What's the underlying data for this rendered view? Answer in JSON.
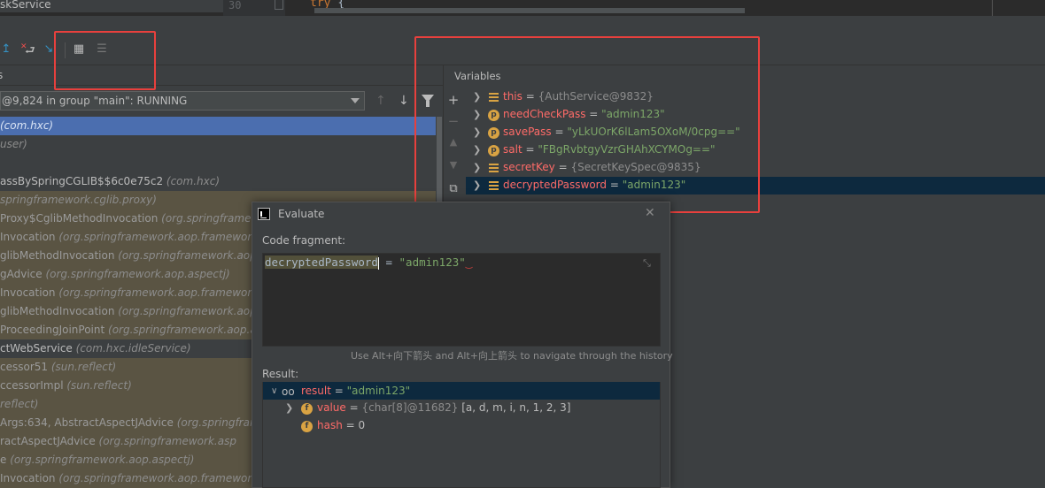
{
  "editor": {
    "file_label": "skService",
    "line_number": "30",
    "code_keyword": "try",
    "code_brace": "{"
  },
  "toolbar": {
    "icons": [
      "step-out-icon",
      "drop-frame-icon",
      "run-to-cursor-icon",
      "evaluate-expression-icon",
      "trace-icon"
    ]
  },
  "frames": {
    "header_label": "s",
    "thread_combo": "@9,824 in group \"main\": RUNNING",
    "items": [
      {
        "method": "",
        "package": "(com.hxc)",
        "selected": true,
        "library": false
      },
      {
        "method": "",
        "package": "user)",
        "selected": false,
        "library": false
      },
      {
        "method": "",
        "package": "",
        "selected": false,
        "library": false
      },
      {
        "method": "assBySpringCGLIB$$6c0e75c2",
        "package": "(com.hxc)",
        "selected": false,
        "library": false
      },
      {
        "method": "",
        "package": "springframework.cglib.proxy)",
        "selected": false,
        "library": true
      },
      {
        "method": "Proxy$CglibMethodInvocation",
        "package": "(org.springframew",
        "selected": false,
        "library": true
      },
      {
        "method": "Invocation",
        "package": "(org.springframework.aop.framework",
        "selected": false,
        "library": true
      },
      {
        "method": "glibMethodInvocation",
        "package": "(org.springframework.aop",
        "selected": false,
        "library": true
      },
      {
        "method": "gAdvice",
        "package": "(org.springframework.aop.aspectj)",
        "selected": false,
        "library": true
      },
      {
        "method": "Invocation",
        "package": "(org.springframework.aop.framework",
        "selected": false,
        "library": true
      },
      {
        "method": "glibMethodInvocation",
        "package": "(org.springframework.aop",
        "selected": false,
        "library": true
      },
      {
        "method": "ProceedingJoinPoint",
        "package": "(org.springframework.aop.a",
        "selected": false,
        "library": true
      },
      {
        "method": "ctWebService",
        "package": "(com.hxc.idleService)",
        "selected": false,
        "library": false
      },
      {
        "method": "cessor51",
        "package": "(sun.reflect)",
        "selected": false,
        "library": true
      },
      {
        "method": "ccessorImpl",
        "package": "(sun.reflect)",
        "selected": false,
        "library": true
      },
      {
        "method": "",
        "package": "reflect)",
        "selected": false,
        "library": true
      },
      {
        "method": "Args:634, AbstractAspectJAdvice",
        "package": "(org.springframe",
        "selected": false,
        "library": true
      },
      {
        "method": "ractAspectJAdvice",
        "package": "(org.springframework.asp",
        "selected": false,
        "library": true
      },
      {
        "method": "e",
        "package": "(org.springframework.aop.aspectj)",
        "selected": false,
        "library": true
      },
      {
        "method": "Invocation",
        "package": "(org.springframework.aop.framework",
        "selected": false,
        "library": true
      }
    ]
  },
  "variables": {
    "title": "Variables",
    "items": [
      {
        "icon": "stack",
        "name": "this",
        "value": "{AuthService@9832}",
        "kind": "obj",
        "selected": false
      },
      {
        "icon": "p",
        "name": "needCheckPass",
        "value": "\"admin123\"",
        "kind": "str",
        "selected": false
      },
      {
        "icon": "p",
        "name": "savePass",
        "value": "\"yLkUOrK6lLam5OXoM/0cpg==\"",
        "kind": "str",
        "selected": false
      },
      {
        "icon": "p",
        "name": "salt",
        "value": "\"FBgRvbtgyVzrGHAhXCYMOg==\"",
        "kind": "str",
        "selected": false
      },
      {
        "icon": "stack",
        "name": "secretKey",
        "value": "{SecretKeySpec@9835}",
        "kind": "obj",
        "selected": false
      },
      {
        "icon": "stack",
        "name": "decryptedPassword",
        "value": "\"admin123\"",
        "kind": "str",
        "selected": true
      }
    ]
  },
  "evaluate": {
    "title": "Evaluate",
    "code_label": "Code fragment:",
    "code_var": "decryptedPassword",
    "code_op": " = ",
    "code_str": "\"admin123\"",
    "history_hint": "Use Alt+向下箭头 and Alt+向上箭头 to navigate through the history",
    "result_label": "Result:",
    "result": {
      "name": "result",
      "value": "\"admin123\"",
      "children": [
        {
          "icon": "f",
          "name": "value",
          "type": "{char[8]@11682}",
          "value": "[a, d, m, i, n, 1, 2, 3]"
        },
        {
          "icon": "f",
          "name": "hash",
          "type": "",
          "value": "0"
        }
      ]
    }
  },
  "colors": {
    "highlight": "#e8403d",
    "selection": "#4b6eaf",
    "library_frame": "#5a5443",
    "string_value": "#7ca668",
    "var_name": "#ff6b68"
  }
}
